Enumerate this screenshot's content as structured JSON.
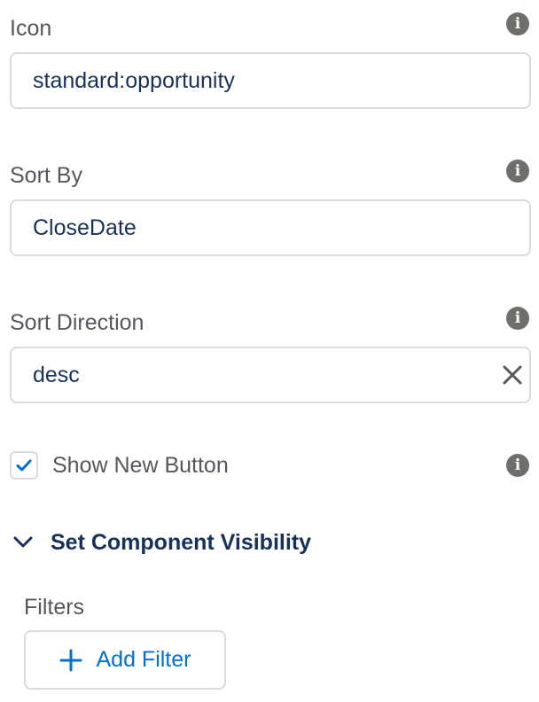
{
  "fields": [
    {
      "label": "Icon",
      "value": "standard:opportunity",
      "info_icon": "info-icon"
    },
    {
      "label": "Sort By",
      "value": "CloseDate",
      "info_icon": "info-icon"
    },
    {
      "label": "Sort Direction",
      "value": "desc",
      "info_icon": "info-icon",
      "clear_icon": "close-icon"
    }
  ],
  "show_new_button": {
    "label": "Show New Button",
    "checked": true,
    "info_icon": "info-icon"
  },
  "visibility_section": {
    "title": "Set Component Visibility",
    "expanded": true,
    "icon": "chevron-down-icon"
  },
  "filters": {
    "label": "Filters",
    "add_button_label": "Add Filter",
    "add_icon": "plus-icon"
  },
  "info_glyph": "i",
  "colors": {
    "label": "#54585d",
    "value_text": "#16325c",
    "border": "#dddbda",
    "info_icon_bg": "#706e6b",
    "check": "#0070d2",
    "link": "#0070d2"
  }
}
